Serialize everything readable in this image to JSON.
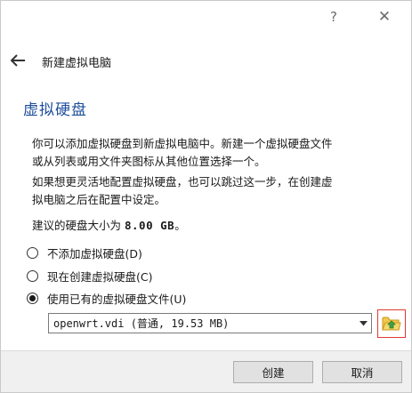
{
  "window": {
    "help_glyph": "?",
    "close_glyph": "✕"
  },
  "nav": {
    "title": "新建虚拟电脑"
  },
  "page": {
    "heading": "虚拟硬盘",
    "para1_line1": "你可以添加虚拟硬盘到新虚拟电脑中。新建一个虚拟硬盘文件",
    "para1_line2": "或从列表或用文件夹图标从其他位置选择一个。",
    "para2_line1": "如果想更灵活地配置虚拟硬盘，也可以跳过这一步，在创建虚",
    "para2_line2": "拟电脑之后在配置中设定。",
    "recommended_prefix": "建议的硬盘大小为",
    "recommended_size": "8.00 GB",
    "recommended_suffix": "。"
  },
  "options": [
    {
      "label": "不添加虚拟硬盘(D)",
      "checked": false
    },
    {
      "label": "现在创建虚拟硬盘(C)",
      "checked": false
    },
    {
      "label": "使用已有的虚拟硬盘文件(U)",
      "checked": true
    }
  ],
  "disk_select": {
    "value": "openwrt.vdi (普通, 19.53 MB)"
  },
  "buttons": {
    "create": "创建",
    "cancel": "取消"
  },
  "colors": {
    "heading": "#1e4f9c",
    "folder_highlight": "#e03a2f"
  },
  "icons": {
    "back": "back-arrow-icon",
    "dropdown": "chevron-down-icon",
    "folder": "folder-open-icon"
  }
}
